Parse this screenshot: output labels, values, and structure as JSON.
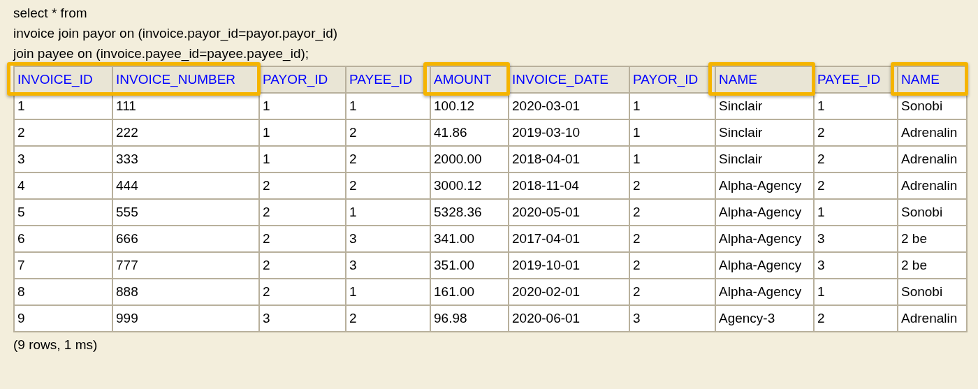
{
  "query": [
    "select * from",
    "invoice join payor on (invoice.payor_id=payor.payor_id)",
    "join payee on (invoice.payee_id=payee.payee_id);"
  ],
  "table": {
    "columns": [
      {
        "label": "INVOICE_ID",
        "highlighted": true
      },
      {
        "label": "INVOICE_NUMBER",
        "highlighted": true
      },
      {
        "label": "PAYOR_ID",
        "highlighted": false
      },
      {
        "label": "PAYEE_ID",
        "highlighted": false
      },
      {
        "label": "AMOUNT",
        "highlighted": true
      },
      {
        "label": "INVOICE_DATE",
        "highlighted": false
      },
      {
        "label": "PAYOR_ID",
        "highlighted": false
      },
      {
        "label": "NAME",
        "highlighted": true
      },
      {
        "label": "PAYEE_ID",
        "highlighted": false
      },
      {
        "label": "NAME",
        "highlighted": true
      }
    ],
    "rows": [
      [
        "1",
        "111",
        "1",
        "1",
        "100.12",
        "2020-03-01",
        "1",
        "Sinclair",
        "1",
        "Sonobi"
      ],
      [
        "2",
        "222",
        "1",
        "2",
        "41.86",
        "2019-03-10",
        "1",
        "Sinclair",
        "2",
        "Adrenalin"
      ],
      [
        "3",
        "333",
        "1",
        "2",
        "2000.00",
        "2018-04-01",
        "1",
        "Sinclair",
        "2",
        "Adrenalin"
      ],
      [
        "4",
        "444",
        "2",
        "2",
        "3000.12",
        "2018-11-04",
        "2",
        "Alpha-Agency",
        "2",
        "Adrenalin"
      ],
      [
        "5",
        "555",
        "2",
        "1",
        "5328.36",
        "2020-05-01",
        "2",
        "Alpha-Agency",
        "1",
        "Sonobi"
      ],
      [
        "6",
        "666",
        "2",
        "3",
        "341.00",
        "2017-04-01",
        "2",
        "Alpha-Agency",
        "3",
        "2 be"
      ],
      [
        "7",
        "777",
        "2",
        "3",
        "351.00",
        "2019-10-01",
        "2",
        "Alpha-Agency",
        "3",
        "2 be"
      ],
      [
        "8",
        "888",
        "2",
        "1",
        "161.00",
        "2020-02-01",
        "2",
        "Alpha-Agency",
        "1",
        "Sonobi"
      ],
      [
        "9",
        "999",
        "3",
        "2",
        "96.98",
        "2020-06-01",
        "3",
        "Agency-3",
        "2",
        "Adrenalin"
      ]
    ]
  },
  "status": "(9 rows, 1 ms)"
}
